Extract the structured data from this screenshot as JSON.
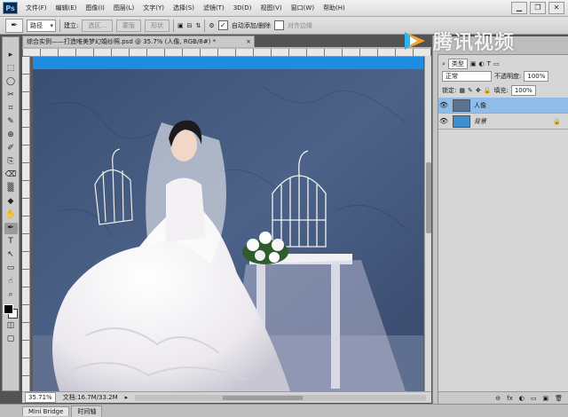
{
  "app": {
    "logo_text": "Ps"
  },
  "menu": [
    "文件(F)",
    "编辑(E)",
    "图像(I)",
    "图层(L)",
    "文字(Y)",
    "选择(S)",
    "滤镜(T)",
    "3D(D)",
    "视图(V)",
    "窗口(W)",
    "帮助(H)"
  ],
  "window_controls": {
    "minimize": "▁",
    "restore": "❐",
    "close": "✕"
  },
  "options": {
    "mode_value": "路径",
    "make_label": "建立:",
    "selection_btn": "选区...",
    "mask_btn": "蒙版",
    "shape_btn": "形状",
    "auto_add_delete": "自动添加/删除",
    "align_edges": "对齐边缘"
  },
  "document": {
    "tab_title": "综合实例——打造唯美梦幻婚纱照.psd @ 35.7% (人像, RGB/8#) *",
    "tab_close": "×",
    "zoom": "35.71%",
    "doc_size": "文档:16.7M/33.2M"
  },
  "bottom_tabs": [
    "Mini Bridge",
    "时间轴"
  ],
  "layers": {
    "blend_mode": "正常",
    "opacity_label": "不透明度:",
    "opacity": "100%",
    "lock_label": "锁定:",
    "fill_label": "填充:",
    "fill": "100%",
    "kind_filter": "类型",
    "items": [
      {
        "name": "人像",
        "selected": true,
        "thumb_color": "#5a7391"
      },
      {
        "name": "背景",
        "selected": false,
        "thumb_color": "#3f8fd0"
      }
    ],
    "footer_icons": [
      "⊖",
      "fx",
      "◐",
      "▭",
      "▣",
      "🗑"
    ]
  },
  "tools": [
    "▸",
    "⬚",
    "◯",
    "✂",
    "⌗",
    "✎",
    "⊕",
    "✐",
    "⎘",
    "⌫",
    "▒",
    "◆",
    "✋",
    "✒",
    "T",
    "↖",
    "▭",
    "☝",
    "⌕"
  ],
  "watermark": {
    "text": "腾讯视频"
  }
}
